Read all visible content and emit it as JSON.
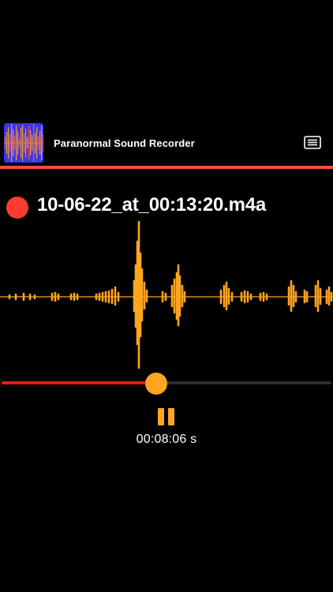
{
  "header": {
    "title": "Paranormal Sound Recorder",
    "app_icon": "waveform-app-icon",
    "menu_icon": "list-icon"
  },
  "recording": {
    "file_name": "10-06-22_at_00:13:20.m4a",
    "status_icon": "record-dot-icon"
  },
  "playback": {
    "elapsed_time": "00:08:06 s",
    "progress": 0.47,
    "control_icon": "pause-icon"
  },
  "colors": {
    "background": "#000000",
    "accent_red": "#ff3b30",
    "divider_red": "#ff4a3d",
    "waveform_orange": "#ffa51f",
    "track_gray": "#2c2c2e",
    "text": "#ffffff",
    "icon_blue": "#3a37e8"
  }
}
